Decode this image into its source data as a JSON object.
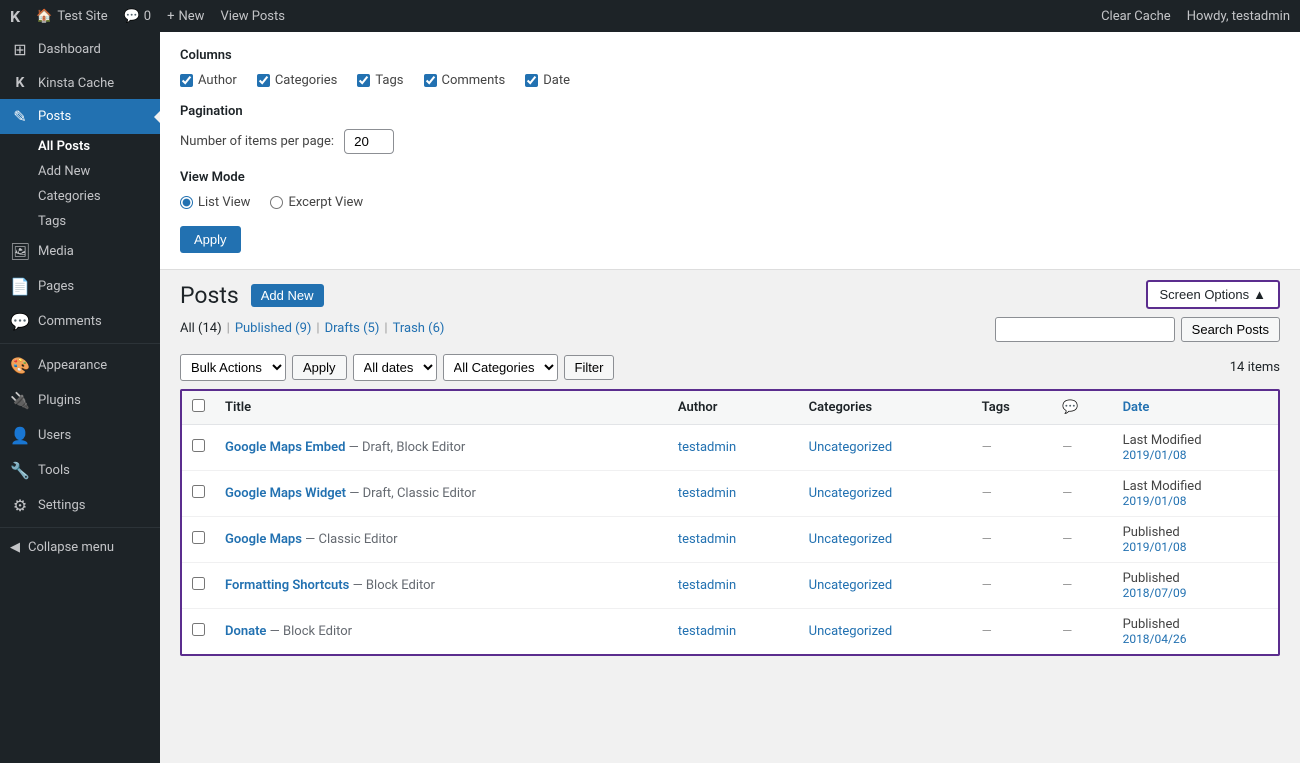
{
  "topbar": {
    "logo": "K",
    "site_name": "Test Site",
    "comments_count": "0",
    "new_label": "New",
    "view_posts": "View Posts",
    "clear_cache": "Clear Cache",
    "howdy": "Howdy, testadmin"
  },
  "sidebar": {
    "items": [
      {
        "id": "dashboard",
        "label": "Dashboard",
        "icon": "⊞"
      },
      {
        "id": "kinsta-cache",
        "label": "Kinsta Cache",
        "icon": "K"
      },
      {
        "id": "posts",
        "label": "Posts",
        "icon": "✎",
        "active": true
      },
      {
        "id": "media",
        "label": "Media",
        "icon": "🖼"
      },
      {
        "id": "pages",
        "label": "Pages",
        "icon": "📄"
      },
      {
        "id": "comments",
        "label": "Comments",
        "icon": "💬"
      },
      {
        "id": "appearance",
        "label": "Appearance",
        "icon": "🎨"
      },
      {
        "id": "plugins",
        "label": "Plugins",
        "icon": "🔌"
      },
      {
        "id": "users",
        "label": "Users",
        "icon": "👤"
      },
      {
        "id": "tools",
        "label": "Tools",
        "icon": "🔧"
      },
      {
        "id": "settings",
        "label": "Settings",
        "icon": "⚙"
      }
    ],
    "posts_submenu": [
      {
        "id": "all-posts",
        "label": "All Posts",
        "active": true
      },
      {
        "id": "add-new",
        "label": "Add New"
      },
      {
        "id": "categories",
        "label": "Categories"
      },
      {
        "id": "tags",
        "label": "Tags"
      }
    ],
    "collapse": "Collapse menu"
  },
  "screen_options": {
    "columns_label": "Columns",
    "checkboxes": [
      {
        "id": "author",
        "label": "Author",
        "checked": true
      },
      {
        "id": "categories",
        "label": "Categories",
        "checked": true
      },
      {
        "id": "tags",
        "label": "Tags",
        "checked": true
      },
      {
        "id": "comments",
        "label": "Comments",
        "checked": true
      },
      {
        "id": "date",
        "label": "Date",
        "checked": true
      }
    ],
    "pagination_label": "Pagination",
    "per_page_label": "Number of items per page:",
    "per_page_value": "20",
    "view_mode_label": "View Mode",
    "view_modes": [
      {
        "id": "list",
        "label": "List View",
        "checked": true
      },
      {
        "id": "excerpt",
        "label": "Excerpt View",
        "checked": false
      }
    ],
    "apply_label": "Apply"
  },
  "posts_section": {
    "title": "Posts",
    "add_new_label": "Add New",
    "screen_options_label": "Screen Options",
    "filter_links": [
      {
        "id": "all",
        "label": "All",
        "count": "(14)",
        "current": true
      },
      {
        "id": "published",
        "label": "Published",
        "count": "(9)"
      },
      {
        "id": "drafts",
        "label": "Drafts",
        "count": "(5)"
      },
      {
        "id": "trash",
        "label": "Trash",
        "count": "(6)"
      }
    ],
    "search_posts_label": "Search Posts",
    "bulk_actions_placeholder": "Bulk Actions",
    "apply_label": "Apply",
    "all_dates_label": "All dates",
    "all_categories_label": "All Categories",
    "filter_label": "Filter",
    "items_count": "14 items",
    "table_headers": [
      {
        "id": "title",
        "label": "Title",
        "sortable": false
      },
      {
        "id": "author",
        "label": "Author",
        "sortable": false
      },
      {
        "id": "categories",
        "label": "Categories",
        "sortable": false
      },
      {
        "id": "tags",
        "label": "Tags",
        "sortable": false
      },
      {
        "id": "comments",
        "label": "💬",
        "sortable": false
      },
      {
        "id": "date",
        "label": "Date",
        "sortable": true
      }
    ],
    "posts": [
      {
        "id": 1,
        "title": "Google Maps Embed",
        "meta": "— Draft, Block Editor",
        "author": "testadmin",
        "category": "Uncategorized",
        "tags": "—",
        "comments": "—",
        "date_label": "Last Modified",
        "date_value": "2019/01/08"
      },
      {
        "id": 2,
        "title": "Google Maps Widget",
        "meta": "— Draft, Classic Editor",
        "author": "testadmin",
        "category": "Uncategorized",
        "tags": "—",
        "comments": "—",
        "date_label": "Last Modified",
        "date_value": "2019/01/08"
      },
      {
        "id": 3,
        "title": "Google Maps",
        "meta": "— Classic Editor",
        "author": "testadmin",
        "category": "Uncategorized",
        "tags": "—",
        "comments": "—",
        "date_label": "Published",
        "date_value": "2019/01/08"
      },
      {
        "id": 4,
        "title": "Formatting Shortcuts",
        "meta": "— Block Editor",
        "author": "testadmin",
        "category": "Uncategorized",
        "tags": "—",
        "comments": "—",
        "date_label": "Published",
        "date_value": "2018/07/09"
      },
      {
        "id": 5,
        "title": "Donate",
        "meta": "— Block Editor",
        "author": "testadmin",
        "category": "Uncategorized",
        "tags": "—",
        "comments": "—",
        "date_label": "Published",
        "date_value": "2018/04/26"
      }
    ]
  }
}
